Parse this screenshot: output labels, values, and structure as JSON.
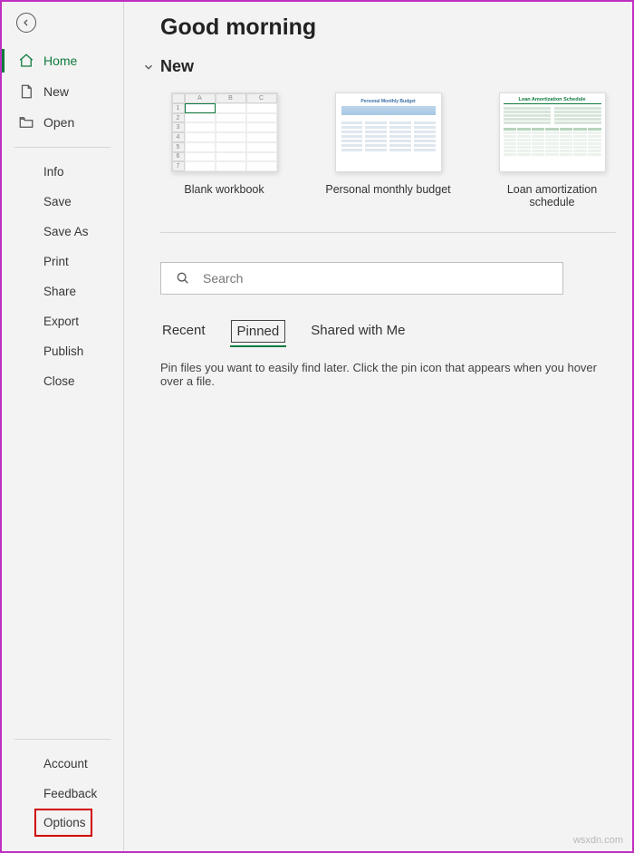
{
  "sidebar": {
    "nav": [
      {
        "id": "home",
        "label": "Home"
      },
      {
        "id": "new",
        "label": "New"
      },
      {
        "id": "open",
        "label": "Open"
      }
    ],
    "file": [
      "Info",
      "Save",
      "Save As",
      "Print",
      "Share",
      "Export",
      "Publish",
      "Close"
    ],
    "bottom": [
      "Account",
      "Feedback",
      "Options"
    ]
  },
  "main": {
    "greeting": "Good morning",
    "section_new": "New",
    "templates": [
      {
        "id": "blank",
        "label": "Blank workbook"
      },
      {
        "id": "budget",
        "label": "Personal monthly budget",
        "thumb_title": "Personal Monthly Budget"
      },
      {
        "id": "loan",
        "label": "Loan amortization schedule",
        "thumb_title": "Loan Amortization Schedule"
      }
    ],
    "search_placeholder": "Search",
    "tabs": [
      {
        "id": "recent",
        "label": "Recent"
      },
      {
        "id": "pinned",
        "label": "Pinned"
      },
      {
        "id": "shared",
        "label": "Shared with Me"
      }
    ],
    "active_tab": "pinned",
    "hint": "Pin files you want to easily find later. Click the pin icon that appears when you hover over a file."
  },
  "watermark": "wsxdn.com"
}
